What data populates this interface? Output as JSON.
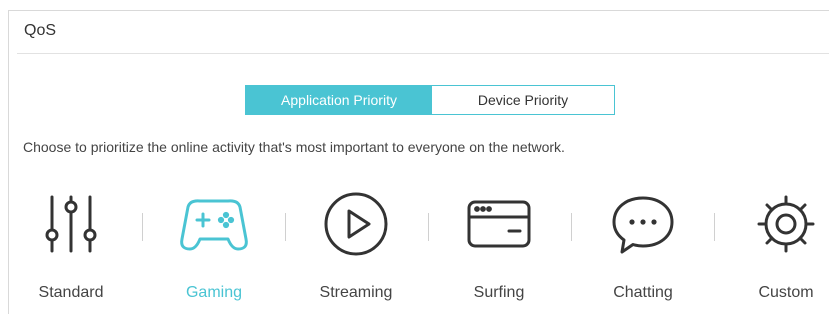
{
  "panel": {
    "title": "QoS"
  },
  "tabs": [
    {
      "label": "Application Priority",
      "active": true
    },
    {
      "label": "Device Priority",
      "active": false
    }
  ],
  "description": "Choose to prioritize the online activity that's most important to everyone on the network.",
  "options": [
    {
      "label": "Standard",
      "icon": "sliders-icon",
      "selected": false
    },
    {
      "label": "Gaming",
      "icon": "gamepad-icon",
      "selected": true
    },
    {
      "label": "Streaming",
      "icon": "play-icon",
      "selected": false
    },
    {
      "label": "Surfing",
      "icon": "browser-window-icon",
      "selected": false
    },
    {
      "label": "Chatting",
      "icon": "chat-bubble-icon",
      "selected": false
    },
    {
      "label": "Custom",
      "icon": "gear-icon",
      "selected": false
    }
  ],
  "colors": {
    "accent": "#4ac4d3",
    "icon": "#333333",
    "text": "#444444"
  }
}
